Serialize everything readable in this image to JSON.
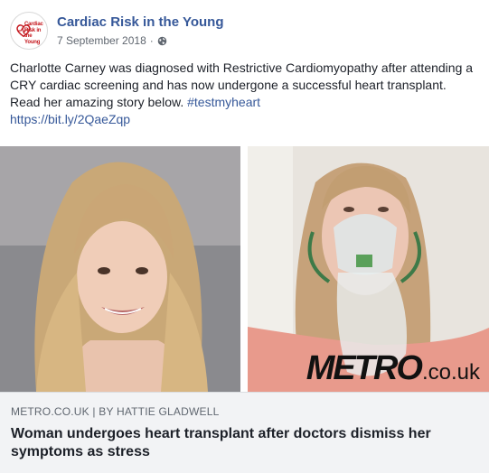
{
  "page": {
    "name": "Cardiac Risk in the Young",
    "date": "7 September 2018",
    "separator": "·",
    "privacy_icon": "globe-icon",
    "logo_text": "Cardiac Risk in the Young"
  },
  "post": {
    "text": "Charlotte Carney was diagnosed with Restrictive Cardiomyopathy after attending a CRY cardiac screening and has now undergone a successful heart transplant. Read her amazing story below.",
    "hashtag": "#testmyheart",
    "link": "https://bit.ly/2QaeZqp"
  },
  "image": {
    "watermark_brand": "METRO",
    "watermark_suffix": ".co.uk"
  },
  "link_preview": {
    "source": "METRO.CO.UK | BY HATTIE GLADWELL",
    "headline": "Woman undergoes heart transplant after doctors dismiss her symptoms as stress"
  },
  "colors": {
    "link": "#365899",
    "brand_red": "#c4161c",
    "preview_bg": "#f2f3f5"
  }
}
